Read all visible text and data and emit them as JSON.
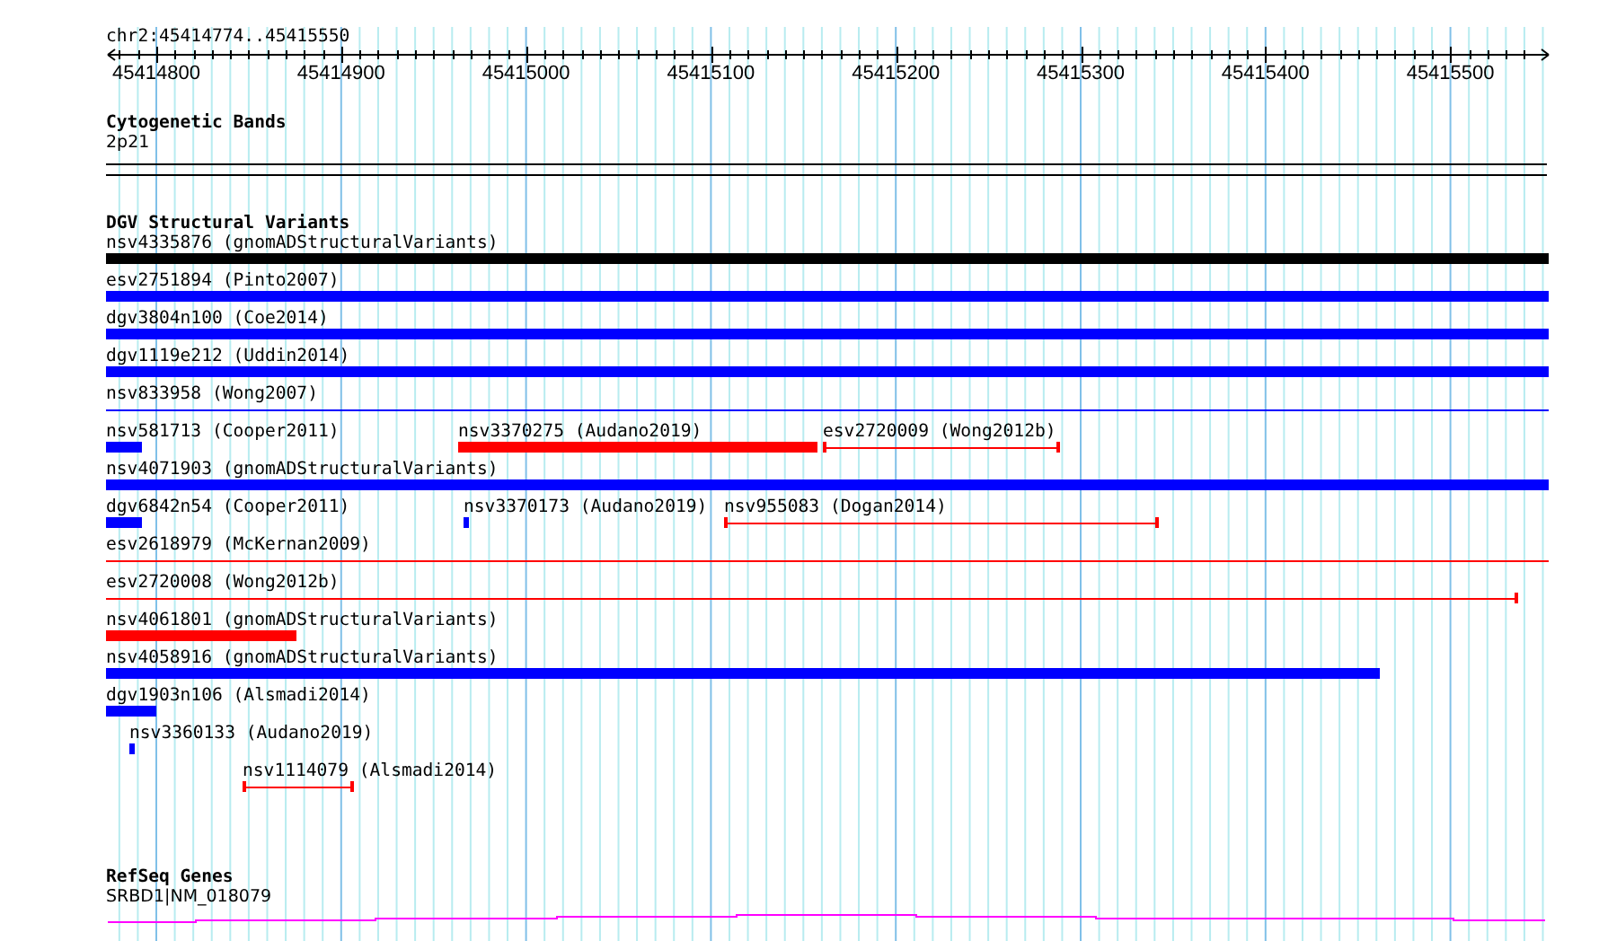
{
  "ruler": {
    "location": "chr2:45414774..45415550",
    "ticks": [
      "45414800",
      "45414900",
      "45415000",
      "45415100",
      "45415200",
      "45415300",
      "45415400",
      "45415500"
    ]
  },
  "cytogenetic_bands": {
    "title": "Cytogenetic Bands",
    "band": "2p21"
  },
  "dgv_structural_variants": {
    "title": "DGV Structural Variants",
    "rows": [
      [
        {
          "label": "nsv4335876 (gnomADStructuralVariants)",
          "kind": "bar",
          "color": "#000000"
        }
      ],
      [
        {
          "label": "esv2751894 (Pinto2007)",
          "kind": "bar",
          "color": "#0000ff"
        }
      ],
      [
        {
          "label": "dgv3804n100 (Coe2014)",
          "kind": "bar",
          "color": "#0000ff"
        }
      ],
      [
        {
          "label": "dgv1119e212 (Uddin2014)",
          "kind": "bar",
          "color": "#0000ff"
        }
      ],
      [
        {
          "label": "nsv833958 (Wong2007)",
          "kind": "line",
          "color": "#0000ff"
        }
      ],
      [
        {
          "label": "nsv581713 (Cooper2011)",
          "kind": "bar",
          "color": "#0000ff"
        },
        {
          "label": "nsv3370275 (Audano2019)",
          "kind": "bar",
          "color": "#ff0000"
        },
        {
          "label": "esv2720009 (Wong2012b)",
          "kind": "line",
          "color": "#ff0000"
        }
      ],
      [
        {
          "label": "nsv4071903 (gnomADStructuralVariants)",
          "kind": "bar",
          "color": "#0000ff"
        }
      ],
      [
        {
          "label": "dgv6842n54 (Cooper2011)",
          "kind": "bar",
          "color": "#0000ff"
        },
        {
          "label": "nsv3370173 (Audano2019)",
          "kind": "bar",
          "color": "#0000ff"
        },
        {
          "label": "nsv955083 (Dogan2014)",
          "kind": "line",
          "color": "#ff0000"
        }
      ],
      [
        {
          "label": "esv2618979 (McKernan2009)",
          "kind": "line",
          "color": "#ff0000"
        }
      ],
      [
        {
          "label": "esv2720008 (Wong2012b)",
          "kind": "line",
          "color": "#ff0000"
        }
      ],
      [
        {
          "label": "nsv4061801 (gnomADStructuralVariants)",
          "kind": "bar",
          "color": "#ff0000"
        }
      ],
      [
        {
          "label": "nsv4058916 (gnomADStructuralVariants)",
          "kind": "bar",
          "color": "#0000ff"
        }
      ],
      [
        {
          "label": "dgv1903n106 (Alsmadi2014)",
          "kind": "bar",
          "color": "#0000ff"
        }
      ],
      [
        {
          "label": "nsv3360133 (Audano2019)",
          "kind": "bar",
          "color": "#0000ff"
        }
      ],
      [
        {
          "label": "nsv1114079 (Alsmadi2014)",
          "kind": "line",
          "color": "#ff0000"
        }
      ]
    ]
  },
  "refseq_genes": {
    "title": "RefSeq Genes",
    "gene": "SRBD1|NM_018079"
  }
}
